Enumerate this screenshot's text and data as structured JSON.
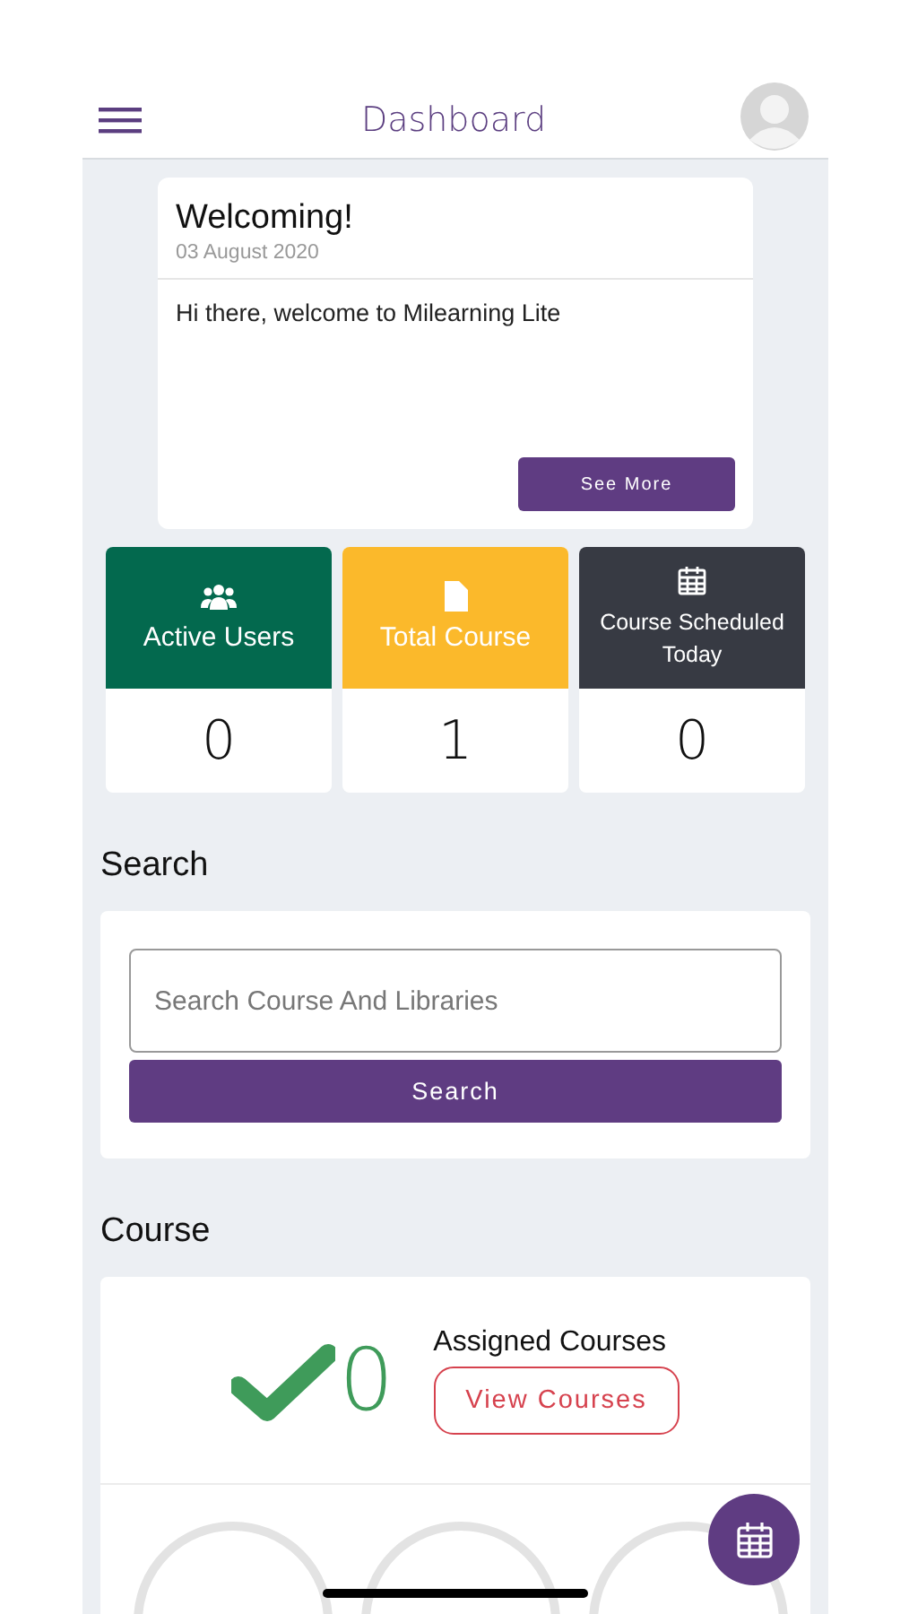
{
  "header": {
    "title": "Dashboard"
  },
  "welcome": {
    "title": "Welcoming!",
    "date": "03 August 2020",
    "message": "Hi there, welcome to Milearning Lite",
    "button": "See More"
  },
  "stats": [
    {
      "kind": "users",
      "label": "Active Users",
      "value": "0",
      "color": "#03694e"
    },
    {
      "kind": "document",
      "label": "Total Course",
      "value": "1",
      "color": "#fbb92b"
    },
    {
      "kind": "calendar",
      "label": "Course Scheduled Today",
      "value": "0",
      "color": "#373a43"
    }
  ],
  "search": {
    "heading": "Search",
    "placeholder": "Search Course And Libraries",
    "button": "Search"
  },
  "course": {
    "heading": "Course",
    "count": "0",
    "label": "Assigned Courses",
    "button": "View Courses"
  }
}
